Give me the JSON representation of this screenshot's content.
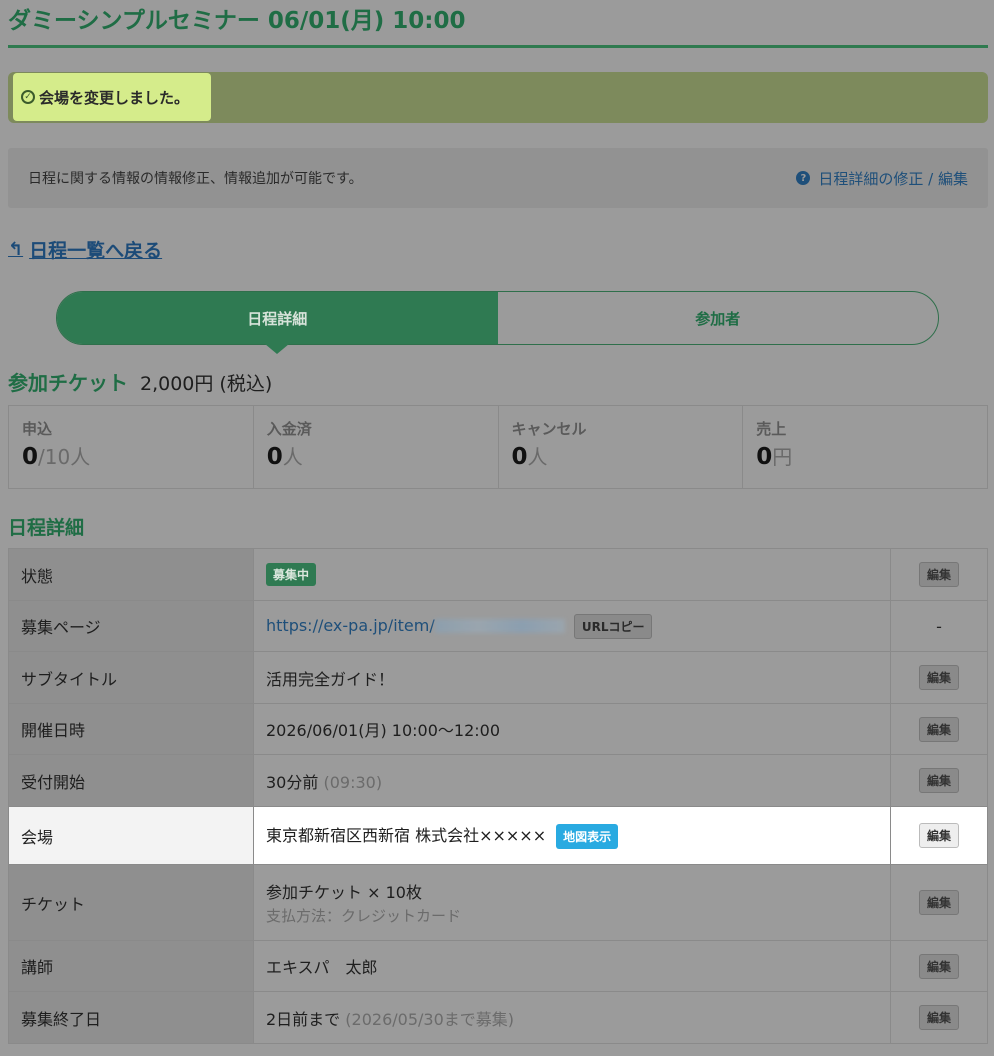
{
  "header": {
    "title": "ダミーシンプルセミナー 06/01(月) 10:00"
  },
  "flash": {
    "message": "会場を変更しました。",
    "icon": "check-circle-icon"
  },
  "info": {
    "text": "日程に関する情報の情報修正、情報追加が可能です。",
    "link_label": "日程詳細の修正 / 編集",
    "link_icon": "question-circle-icon"
  },
  "nav": {
    "back_label": "日程一覧へ戻る"
  },
  "tabs": [
    {
      "label": "日程詳細",
      "active": true
    },
    {
      "label": "参加者",
      "active": false
    }
  ],
  "ticket": {
    "name": "参加チケット",
    "price": "2,000円 (税込)"
  },
  "stats": [
    {
      "label": "申込",
      "value": "0",
      "unit": "/10人"
    },
    {
      "label": "入金済",
      "value": "0",
      "unit": "人"
    },
    {
      "label": "キャンセル",
      "value": "0",
      "unit": "人"
    },
    {
      "label": "売上",
      "value": "0",
      "unit": "円"
    }
  ],
  "detail": {
    "title": "日程詳細",
    "edit_label": "編集",
    "rows": {
      "status": {
        "key": "状態",
        "badge": "募集中"
      },
      "page": {
        "key": "募集ページ",
        "url": "https://ex-pa.jp/item/",
        "copy_label": "URLコピー",
        "action": "-"
      },
      "subtitle": {
        "key": "サブタイトル",
        "value": "活用完全ガイド！"
      },
      "datetime": {
        "key": "開催日時",
        "value": "2026/06/01(月) 10:00〜12:00"
      },
      "reception": {
        "key": "受付開始",
        "value": "30分前",
        "note": "(09:30)"
      },
      "venue": {
        "key": "会場",
        "value": "東京都新宿区西新宿 株式会社×××××",
        "map_label": "地図表示"
      },
      "ticket": {
        "key": "チケット",
        "value": "参加チケット × 10枚",
        "sub": "支払方法：クレジットカード"
      },
      "lecturer": {
        "key": "講師",
        "value": "エキスパ　太郎"
      },
      "deadline": {
        "key": "募集終了日",
        "value": "2日前まで",
        "note": "(2026/05/30まで募集)"
      }
    }
  },
  "colors": {
    "brand_green": "#2f7a52",
    "link_blue": "#1e4f7a",
    "flash_bg": "#d5ec8b",
    "map_badge": "#29aae1"
  }
}
